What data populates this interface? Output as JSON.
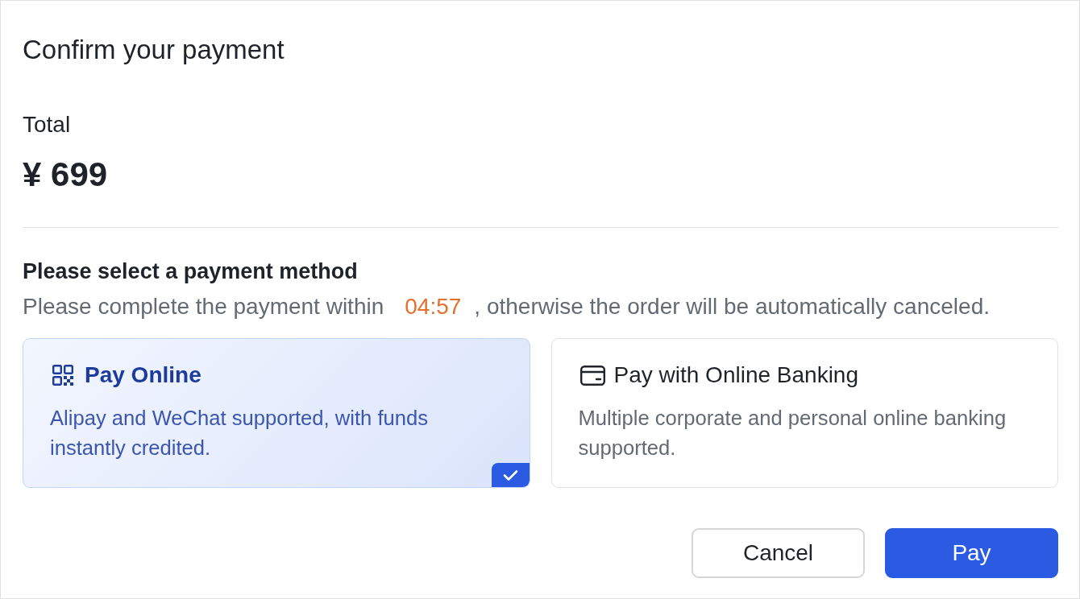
{
  "dialog": {
    "title": "Confirm your payment"
  },
  "total": {
    "label": "Total",
    "amount": "¥ 699"
  },
  "payment_method": {
    "heading": "Please select a payment method",
    "deadline": {
      "before": "Please complete the payment within",
      "timer": "04:57",
      "after": ", otherwise the order will be automatically canceled."
    },
    "options": [
      {
        "kind": "qr",
        "title": "Pay Online",
        "description": "Alipay and WeChat supported, with funds instantly credited.",
        "selected": true
      },
      {
        "kind": "card",
        "title": "Pay with Online Banking",
        "description": "Multiple corporate and personal online banking supported.",
        "selected": false
      }
    ]
  },
  "buttons": [
    {
      "kind": "secondary",
      "label": "Cancel"
    },
    {
      "kind": "primary",
      "label": "Pay"
    }
  ]
}
